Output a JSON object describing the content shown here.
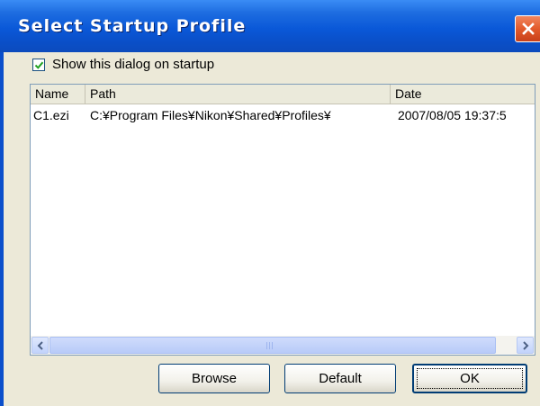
{
  "dialog": {
    "title": "Select Startup Profile",
    "colors": {
      "titlebar": "#0a58d8",
      "close_button": "#e35a2b",
      "face": "#ece9d8"
    }
  },
  "checkbox": {
    "label": "Show this dialog on startup",
    "checked": true
  },
  "list": {
    "columns": [
      "Name",
      "Path",
      "Date"
    ],
    "rows": [
      {
        "name": "C1.ezi",
        "path": "C:¥Program Files¥Nikon¥Shared¥Profiles¥",
        "date": "2007/08/05 19:37:5"
      }
    ]
  },
  "buttons": {
    "browse": "Browse",
    "default": "Default",
    "ok": "OK"
  },
  "icons": {
    "close": "close-icon",
    "check": "checkmark-icon",
    "scroll_left": "arrow-left-icon",
    "scroll_right": "arrow-right-icon"
  }
}
